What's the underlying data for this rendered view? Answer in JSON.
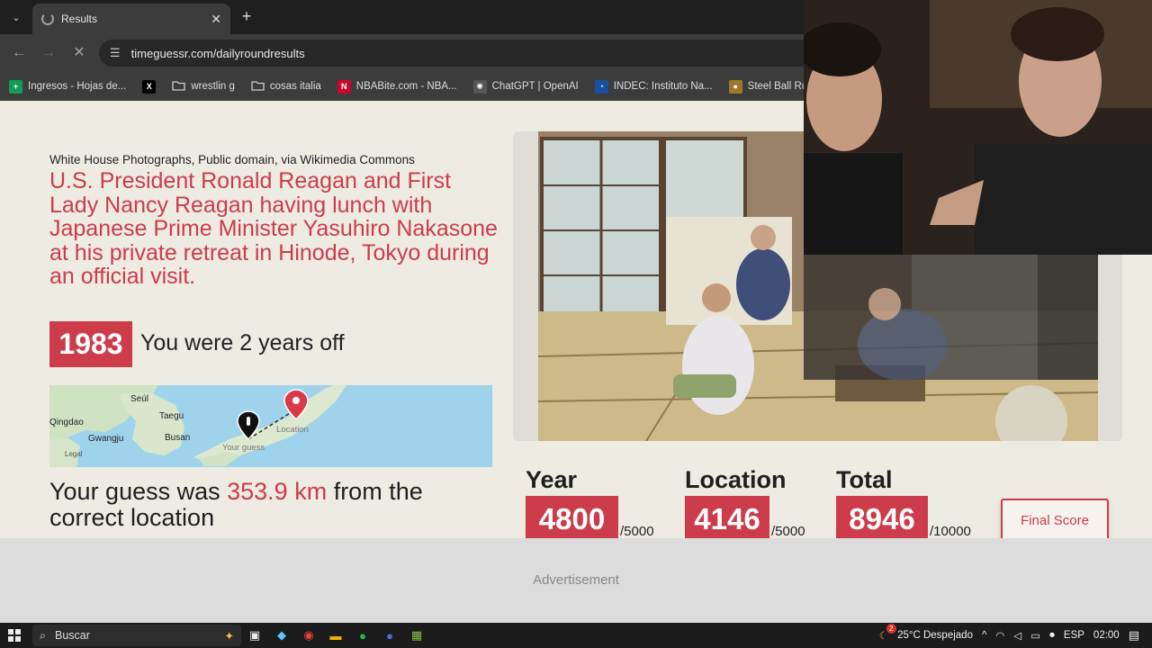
{
  "browser": {
    "tab_title": "Results",
    "url": "timeguessr.com/dailyroundresults",
    "bookmarks": [
      {
        "label": "Ingresos - Hojas de...",
        "icon": "sheets-icon",
        "color": "#0f9d58",
        "glyph": "+"
      },
      {
        "label": "",
        "icon": "x-icon",
        "color": "#000000",
        "glyph": "X"
      },
      {
        "label": "wrestlin g",
        "icon": "folder-icon",
        "color": "",
        "glyph": ""
      },
      {
        "label": "cosas italia",
        "icon": "folder-icon",
        "color": "",
        "glyph": ""
      },
      {
        "label": "NBABite.com - NBA...",
        "icon": "nba-icon",
        "color": "#c9082a",
        "glyph": "N"
      },
      {
        "label": "ChatGPT | OpenAI",
        "icon": "openai-icon",
        "color": "#555555",
        "glyph": "✺"
      },
      {
        "label": "INDEC: Instituto Na...",
        "icon": "indec-icon",
        "color": "#1a4fa0",
        "glyph": "◔"
      },
      {
        "label": "Steel Ball Run Man",
        "icon": "manga-icon",
        "color": "#a0782a",
        "glyph": "●"
      }
    ]
  },
  "result": {
    "credit": "White House Photographs, Public domain, via Wikimedia Commons",
    "caption": "U.S. President Ronald Reagan and First Lady Nancy Reagan having lunch with Japanese Prime Minister Yasuhiro Nakasone at his private retreat in Hinode, Tokyo during an official visit.",
    "year": "1983",
    "years_off": "You were 2 years off",
    "guess_prefix": "Your guess was ",
    "guess_km": "353.9 km",
    "guess_suffix": " from the correct location"
  },
  "map": {
    "labels": {
      "seoul": "Seúl",
      "qingdao": "Qingdao",
      "taegu": "Taegu",
      "gwangju": "Gwangju",
      "busan": "Busan",
      "location": "Location",
      "your_guess": "Your guess",
      "legal": "Legal"
    }
  },
  "scores": {
    "year_label": "Year",
    "year_value": "4800",
    "year_max": "/5000",
    "location_label": "Location",
    "location_value": "4146",
    "location_max": "/5000",
    "total_label": "Total",
    "total_value": "8946",
    "total_max": "/10000",
    "final_button": "Final Score"
  },
  "ad": {
    "label": "Advertisement"
  },
  "taskbar": {
    "search_placeholder": "Buscar",
    "weather_badge": "2",
    "weather": "25°C  Despejado",
    "language": "ESP",
    "time": "02:00"
  },
  "colors": {
    "accent": "#cc3c4a",
    "page_bg": "#eeebe3"
  }
}
